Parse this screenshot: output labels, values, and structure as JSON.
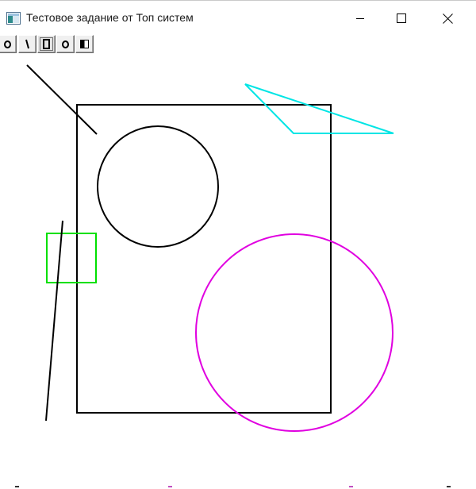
{
  "window": {
    "title": "Тестовое задание от Топ систем",
    "controls": [
      "minimize",
      "maximize",
      "close"
    ]
  },
  "toolbar": {
    "tools": [
      {
        "name": "circle-tool",
        "icon": "circle-icon",
        "active": false
      },
      {
        "name": "line-tool",
        "icon": "line-icon",
        "active": false
      },
      {
        "name": "rectangle-tool",
        "icon": "rectangle-icon",
        "active": true
      },
      {
        "name": "ellipse-tool",
        "icon": "circle-icon",
        "active": false
      },
      {
        "name": "fill-tool",
        "icon": "half-filled-square-icon",
        "active": false
      }
    ]
  },
  "colors": {
    "black": "#000000",
    "cyan": "#00e5e5",
    "green": "#00e000",
    "magenta": "#e000e0",
    "accent": "#0078d7"
  },
  "shapes": [
    {
      "type": "line",
      "color": "black"
    },
    {
      "type": "rectangle",
      "color": "black"
    },
    {
      "type": "circle",
      "color": "black"
    },
    {
      "type": "triangle",
      "color": "cyan"
    },
    {
      "type": "rectangle",
      "color": "green"
    },
    {
      "type": "line",
      "color": "black"
    },
    {
      "type": "circle",
      "color": "magenta"
    }
  ]
}
